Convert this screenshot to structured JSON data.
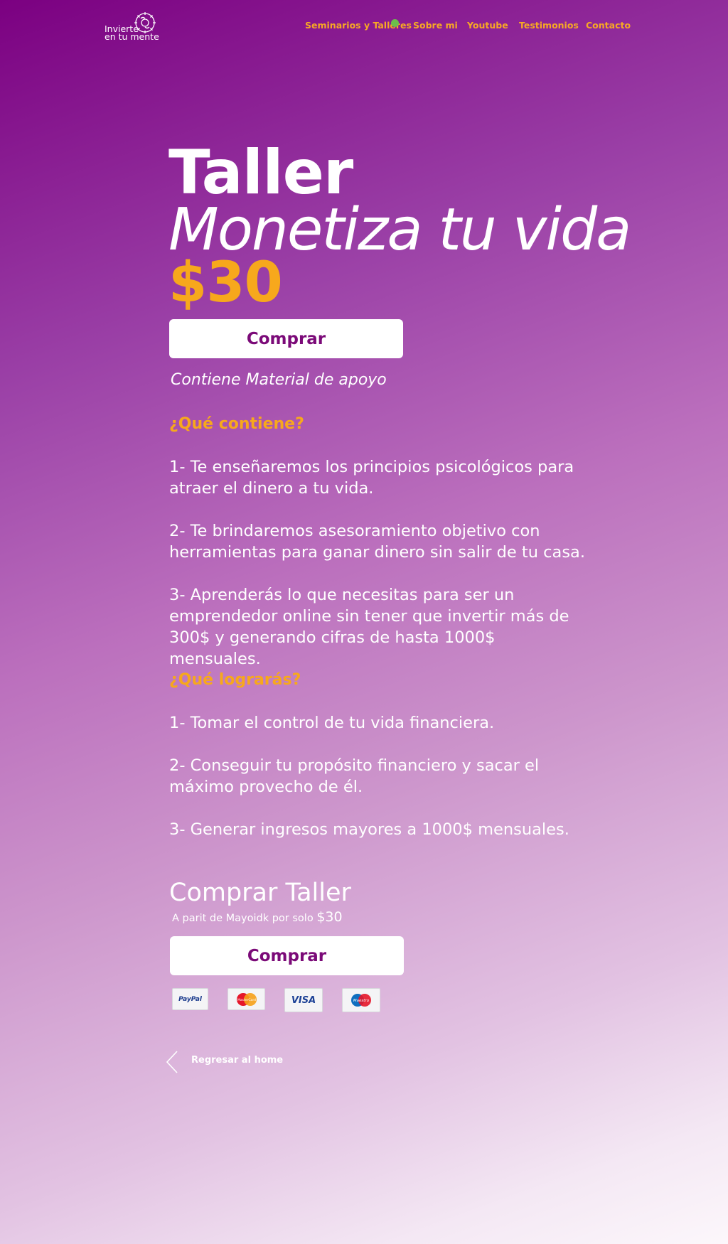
{
  "header": {
    "logo_line1": "Invierte",
    "logo_line2": "en tu mente",
    "nav": [
      "Seminarios y Talleres",
      "Sobre mi",
      "Youtube",
      "Testimonios",
      "Contacto"
    ]
  },
  "hero": {
    "title": "Taller",
    "subtitle": "Monetiza tu vida",
    "price": "$30",
    "buy_label": "Comprar",
    "material_note": "Contiene Material de apoyo"
  },
  "contains": {
    "heading": "¿Qué contiene?",
    "items": [
      "1- Te enseñaremos los principios psicológicos para atraer el dinero a tu vida.",
      "2- Te brindaremos asesoramiento objetivo con herramientas para ganar dinero sin salir de tu casa.",
      "3- Aprenderás lo que necesitas para ser un emprendedor online sin tener que invertir más de 300$ y generando cifras de hasta 1000$ mensuales."
    ]
  },
  "achieve": {
    "heading": "¿Qué lograrás?",
    "items": [
      "1- Tomar el control de tu vida financiera.",
      "2- Conseguir tu propósito financiero y sacar el máximo provecho de él.",
      "3- Generar ingresos mayores a 1000$ mensuales."
    ]
  },
  "purchase": {
    "heading": "Comprar Taller",
    "note": "A parit de Mayoidk por solo",
    "note_price": "$30",
    "buy_label": "Comprar",
    "payment_methods": [
      "PayPal",
      "MasterCard",
      "VISA",
      "Maestro"
    ]
  },
  "footer": {
    "back_label": "Regresar al home"
  },
  "colors": {
    "accent": "#f7a81c",
    "brand_purple": "#7b0a78",
    "nav_dot": "#6cc04a"
  }
}
